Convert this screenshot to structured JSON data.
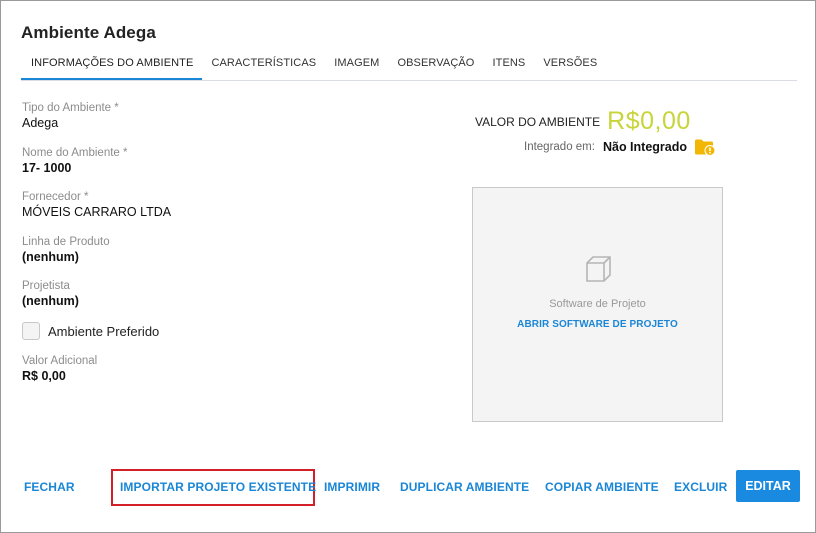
{
  "title": "Ambiente Adega",
  "tabs": [
    {
      "label": "INFORMAÇÕES DO AMBIENTE",
      "active": true
    },
    {
      "label": "CARACTERÍSTICAS"
    },
    {
      "label": "IMAGEM"
    },
    {
      "label": "OBSERVAÇÃO"
    },
    {
      "label": "ITENS"
    },
    {
      "label": "VERSÕES"
    }
  ],
  "fields": {
    "tipo": {
      "label": "Tipo do Ambiente *",
      "value": "Adega"
    },
    "nome": {
      "label": "Nome do Ambiente *",
      "value": "17- 1000"
    },
    "fornecedor": {
      "label": "Fornecedor *",
      "value": "MÓVEIS CARRARO LTDA"
    },
    "linha": {
      "label": "Linha de Produto",
      "value": "(nenhum)"
    },
    "projetista": {
      "label": "Projetista",
      "value": "(nenhum)"
    },
    "preferido": {
      "label": "Ambiente Preferido",
      "checked": false
    },
    "valor_adicional": {
      "label": "Valor Adicional",
      "value": "R$ 0,00"
    }
  },
  "valor": {
    "label": "VALOR DO AMBIENTE",
    "amount": "R$0,00",
    "color": "#c8d43a"
  },
  "integrado": {
    "label": "Integrado em:",
    "value": "Não Integrado",
    "icon": "folder-sync-icon"
  },
  "project_box": {
    "label": "Software de Projeto",
    "link": "ABRIR SOFTWARE DE PROJETO",
    "icon": "cube-icon"
  },
  "footer": {
    "fechar": "FECHAR",
    "importar": "IMPORTAR PROJETO EXISTENTE",
    "imprimir": "IMPRIMIR",
    "duplicar": "DUPLICAR AMBIENTE",
    "copiar": "COPIAR AMBIENTE",
    "excluir": "EXCLUIR",
    "editar": "EDITAR"
  },
  "colors": {
    "accent": "#1a86d6",
    "highlight": "#d32028",
    "primary_button": "#1a8ae0"
  }
}
